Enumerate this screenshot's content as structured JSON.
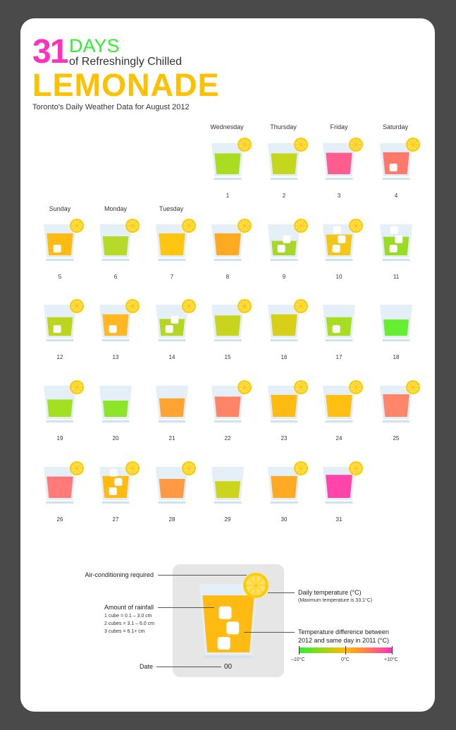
{
  "colors": {
    "background": "#4a4a4a",
    "card": "#ffffff",
    "glass": "#e4eff7",
    "glass_base": "#cfe2ee",
    "lemon": "#ffcc00",
    "ice": "#ffffff",
    "scale_start": "#33ee33",
    "scale_mid": "#ffbb00",
    "scale_end": "#ff33bb"
  },
  "header": {
    "number": "31",
    "days": "DAYS",
    "subtitle": "of Refreshingly Chilled",
    "title": "LEMONADE",
    "description": "Toronto's Daily Weather Data for August 2012"
  },
  "weekdays": [
    "Sunday",
    "Monday",
    "Tuesday",
    "Wednesday",
    "Thursday",
    "Friday",
    "Saturday"
  ],
  "chart_data": {
    "type": "table",
    "max_temperature_c": 33.1,
    "days": [
      {
        "date": "1",
        "level": 0.72,
        "color": "#aadd22",
        "cubes": 0,
        "lemon": true
      },
      {
        "date": "2",
        "level": 0.72,
        "color": "#c4d61e",
        "cubes": 0,
        "lemon": true
      },
      {
        "date": "3",
        "level": 0.74,
        "color": "#ff5c8f",
        "cubes": 0,
        "lemon": true
      },
      {
        "date": "4",
        "level": 0.76,
        "color": "#ff7a6a",
        "cubes": 1,
        "lemon": true
      },
      {
        "date": "5",
        "level": 0.76,
        "color": "#ffbb11",
        "cubes": 1,
        "lemon": true
      },
      {
        "date": "6",
        "level": 0.66,
        "color": "#b7d92a",
        "cubes": 0,
        "lemon": true
      },
      {
        "date": "7",
        "level": 0.76,
        "color": "#ffc611",
        "cubes": 0,
        "lemon": true
      },
      {
        "date": "8",
        "level": 0.76,
        "color": "#ffaa22",
        "cubes": 0,
        "lemon": true
      },
      {
        "date": "9",
        "level": 0.5,
        "color": "#a8d62a",
        "cubes": 2,
        "lemon": true
      },
      {
        "date": "10",
        "level": 0.72,
        "color": "#f5c61a",
        "cubes": 3,
        "lemon": true
      },
      {
        "date": "11",
        "level": 0.64,
        "color": "#99dd22",
        "cubes": 3,
        "lemon": false
      },
      {
        "date": "12",
        "level": 0.64,
        "color": "#bcd61e",
        "cubes": 1,
        "lemon": true
      },
      {
        "date": "13",
        "level": 0.74,
        "color": "#ffb822",
        "cubes": 1,
        "lemon": true
      },
      {
        "date": "14",
        "level": 0.58,
        "color": "#b5d622",
        "cubes": 2,
        "lemon": true
      },
      {
        "date": "15",
        "level": 0.7,
        "color": "#c8d41e",
        "cubes": 0,
        "lemon": true
      },
      {
        "date": "16",
        "level": 0.74,
        "color": "#d8d018",
        "cubes": 0,
        "lemon": true
      },
      {
        "date": "17",
        "level": 0.64,
        "color": "#a8dd22",
        "cubes": 1,
        "lemon": false
      },
      {
        "date": "18",
        "level": 0.56,
        "color": "#66ee33",
        "cubes": 0,
        "lemon": false
      },
      {
        "date": "19",
        "level": 0.6,
        "color": "#a4e022",
        "cubes": 0,
        "lemon": true
      },
      {
        "date": "20",
        "level": 0.56,
        "color": "#8de52a",
        "cubes": 0,
        "lemon": false
      },
      {
        "date": "21",
        "level": 0.64,
        "color": "#ffa333",
        "cubes": 0,
        "lemon": false
      },
      {
        "date": "22",
        "level": 0.7,
        "color": "#ff8566",
        "cubes": 0,
        "lemon": true
      },
      {
        "date": "23",
        "level": 0.76,
        "color": "#ffbb11",
        "cubes": 0,
        "lemon": true
      },
      {
        "date": "24",
        "level": 0.76,
        "color": "#ffc011",
        "cubes": 0,
        "lemon": true
      },
      {
        "date": "25",
        "level": 0.78,
        "color": "#ff866a",
        "cubes": 0,
        "lemon": true
      },
      {
        "date": "26",
        "level": 0.74,
        "color": "#ff7a78",
        "cubes": 0,
        "lemon": true
      },
      {
        "date": "27",
        "level": 0.76,
        "color": "#ffbb11",
        "cubes": 3,
        "lemon": true
      },
      {
        "date": "28",
        "level": 0.66,
        "color": "#ff9944",
        "cubes": 0,
        "lemon": true
      },
      {
        "date": "29",
        "level": 0.58,
        "color": "#ccd41e",
        "cubes": 0,
        "lemon": false
      },
      {
        "date": "30",
        "level": 0.76,
        "color": "#ffaa22",
        "cubes": 0,
        "lemon": true
      },
      {
        "date": "31",
        "level": 0.8,
        "color": "#ff44aa",
        "cubes": 0,
        "lemon": true
      }
    ]
  },
  "legend": {
    "air_conditioning": "Air-conditioning required",
    "daily_temperature": "Daily temperature (°C)",
    "max_temperature_note": "(Maximum temperature is 33.1°C)",
    "rainfall_title": "Amount of rainfall",
    "rainfall_1": "1 cube = 0.1 – 3.0 cm",
    "rainfall_2": "2 cubes = 3.1 – 6.0 cm",
    "rainfall_3": "3 cubes = 6.1+ cm",
    "temp_diff_1": "Temperature difference between",
    "temp_diff_2": "2012 and same day in 2011 (°C)",
    "scale_min": "–10°C",
    "scale_mid": "0°C",
    "scale_max": "+10°C",
    "date_label": "Date",
    "date_value": "00",
    "example_color": "#ffbb11",
    "example_cubes": 3
  }
}
